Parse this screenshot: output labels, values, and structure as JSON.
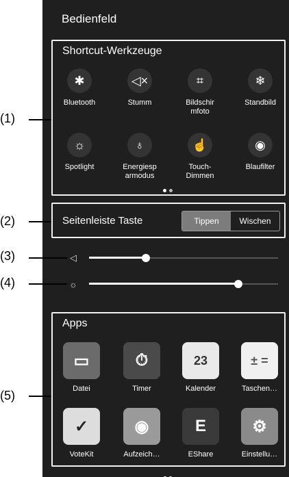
{
  "panel": {
    "title": "Bedienfeld"
  },
  "shortcuts": {
    "title": "Shortcut-Werkzeuge",
    "items": [
      {
        "label": "Bluetooth",
        "icon": "bluetooth-icon",
        "glyph": "✱"
      },
      {
        "label": "Stumm",
        "icon": "mute-icon",
        "glyph": "◁×"
      },
      {
        "label": "Bildschir\nmfoto",
        "icon": "screenshot-icon",
        "glyph": "⌗"
      },
      {
        "label": "Standbild",
        "icon": "freeze-icon",
        "glyph": "❄"
      },
      {
        "label": "Spotlight",
        "icon": "spotlight-icon",
        "glyph": "☼"
      },
      {
        "label": "Energiesp\narmodus",
        "icon": "energy-saving-icon",
        "glyph": "♁"
      },
      {
        "label": "Touch-\nDimmen",
        "icon": "touch-dim-icon",
        "glyph": "☝"
      },
      {
        "label": "Blaufilter",
        "icon": "blue-filter-icon",
        "glyph": "◉"
      }
    ]
  },
  "sidebar": {
    "label": "Seitenleiste Taste",
    "options": [
      "Tippen",
      "Wischen"
    ],
    "selected": "Tippen"
  },
  "volume": {
    "icon": "speaker-icon",
    "glyph": "◁",
    "level": 0.3
  },
  "brightness": {
    "icon": "brightness-icon",
    "glyph": "☼",
    "level": 0.79
  },
  "apps": {
    "title": "Apps",
    "items": [
      {
        "label": "Datei",
        "icon": "folder-icon",
        "glyph": "▭",
        "color": "#6b6b6b",
        "fg": "#ffffff"
      },
      {
        "label": "Timer",
        "icon": "stopwatch-icon",
        "glyph": "⏱",
        "color": "#4a4a4a",
        "fg": "#ffffff"
      },
      {
        "label": "Kalender",
        "icon": "calendar-icon",
        "glyph": "23",
        "color": "#e9e9e9",
        "fg": "#333333"
      },
      {
        "label": "Taschen…",
        "icon": "calculator-icon",
        "glyph": "± =",
        "color": "#f0f0f0",
        "fg": "#555555"
      },
      {
        "label": "VoteKit",
        "icon": "vote-icon",
        "glyph": "✓",
        "color": "#dddddd",
        "fg": "#222222"
      },
      {
        "label": "Aufzeich…",
        "icon": "record-icon",
        "glyph": "◉",
        "color": "#9a9a9a",
        "fg": "#ffffff"
      },
      {
        "label": "EShare",
        "icon": "eshare-icon",
        "glyph": "E",
        "color": "#3a3a3a",
        "fg": "#ffffff"
      },
      {
        "label": "Einstellu…",
        "icon": "settings-icon",
        "glyph": "⚙",
        "color": "#8a8a8a",
        "fg": "#ffffff"
      }
    ]
  },
  "callouts": [
    "(1)",
    "(2)",
    "(3)",
    "(4)",
    "(5)"
  ]
}
